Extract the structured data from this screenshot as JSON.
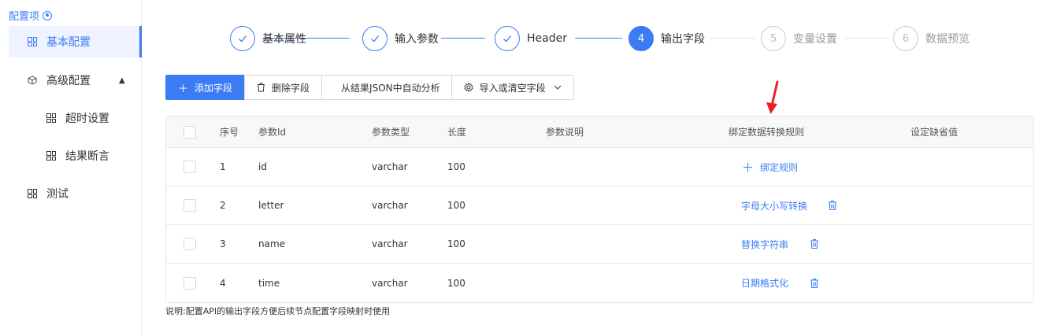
{
  "sidebar": {
    "title": "配置项",
    "items": [
      {
        "label": "基本配置"
      },
      {
        "label": "高级配置"
      },
      {
        "label": "超时设置"
      },
      {
        "label": "结果断言"
      },
      {
        "label": "测试"
      }
    ]
  },
  "steps": [
    {
      "num": "",
      "label": "基本属性",
      "state": "done"
    },
    {
      "num": "",
      "label": "输入参数",
      "state": "done"
    },
    {
      "num": "",
      "label": "Header",
      "state": "done"
    },
    {
      "num": "4",
      "label": "输出字段",
      "state": "active"
    },
    {
      "num": "5",
      "label": "变量设置",
      "state": "wait"
    },
    {
      "num": "6",
      "label": "数据预览",
      "state": "wait"
    }
  ],
  "toolbar": {
    "add_label": "添加字段",
    "delete_label": "删除字段",
    "auto_label": "从结果JSON中自动分析",
    "import_label": "导入或清空字段"
  },
  "table": {
    "headers": [
      "序号",
      "参数Id",
      "参数类型",
      "长度",
      "参数说明",
      "绑定数据转换规则",
      "设定缺省值"
    ],
    "rows": [
      {
        "index": "1",
        "id": "id",
        "type": "varchar",
        "length": "100",
        "desc": "",
        "rule": "绑定规则",
        "rule_kind": "add",
        "default": ""
      },
      {
        "index": "2",
        "id": "letter",
        "type": "varchar",
        "length": "100",
        "desc": "",
        "rule": "字母大小写转换",
        "rule_kind": "bound",
        "default": ""
      },
      {
        "index": "3",
        "id": "name",
        "type": "varchar",
        "length": "100",
        "desc": "",
        "rule": "替换字符串",
        "rule_kind": "bound",
        "default": ""
      },
      {
        "index": "4",
        "id": "time",
        "type": "varchar",
        "length": "100",
        "desc": "",
        "rule": "日期格式化",
        "rule_kind": "bound",
        "default": ""
      }
    ]
  },
  "note": "说明:配置API的输出字段方便后续节点配置字段映射时使用",
  "colors": {
    "accent": "#3b7cf4",
    "arrow": "#e8202a"
  }
}
